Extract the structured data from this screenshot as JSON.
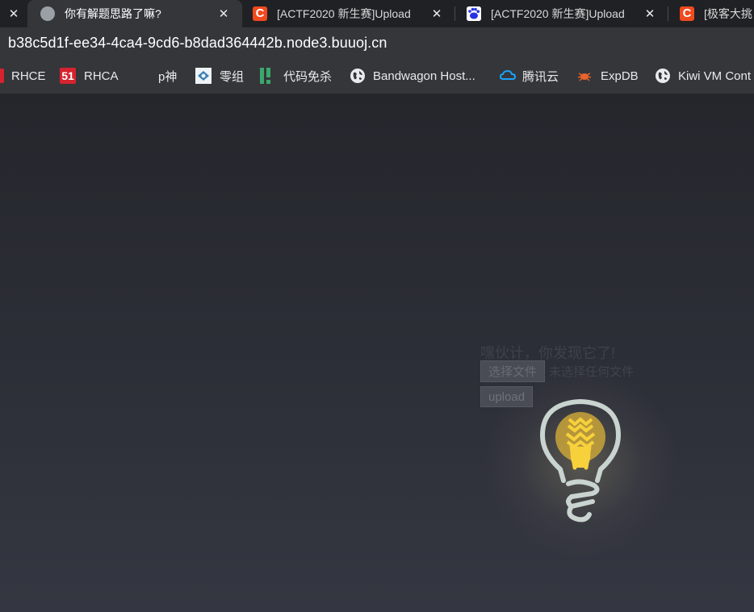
{
  "tabs": [
    {
      "title": "",
      "active": false,
      "icon": "close-icon"
    },
    {
      "title": "你有解题思路了嘛?",
      "active": true,
      "icon": "globe-icon"
    },
    {
      "title": "[ACTF2020 新生赛]Upload",
      "active": false,
      "icon": "csdn-icon"
    },
    {
      "title": "[ACTF2020 新生赛]Upload",
      "active": false,
      "icon": "baidu-icon"
    },
    {
      "title": "[极客大挑",
      "active": false,
      "icon": "csdn-icon"
    }
  ],
  "address_bar": {
    "url": "b38c5d1f-ee34-4ca4-9cd6-b8dad364442b.node3.buuoj.cn"
  },
  "bookmarks": [
    {
      "label": "RHCE",
      "icon": "rhce-icon"
    },
    {
      "label": "RHCA",
      "icon": "51-icon"
    },
    {
      "label": "p神",
      "icon": ""
    },
    {
      "label": "零组",
      "icon": "zero-group-icon"
    },
    {
      "label": "代码免杀",
      "icon": "code-icon"
    },
    {
      "label": "Bandwagon Host...",
      "icon": "globe-icon"
    },
    {
      "label": "腾讯云",
      "icon": "cloud-icon"
    },
    {
      "label": "ExpDB",
      "icon": "bug-icon"
    },
    {
      "label": "Kiwi VM Cont",
      "icon": "globe-icon"
    }
  ],
  "page": {
    "hint": "嘿伙计，你发现它了!",
    "choose_file_label": "选择文件",
    "file_status": "未选择任何文件",
    "upload_label": "upload"
  },
  "colors": {
    "tabstrip": "#202124",
    "toolbar": "#35363a",
    "page_bg": "#2b2d35",
    "bulb_outline": "#c9d3cf",
    "bulb_fill": "#f7d13b"
  }
}
